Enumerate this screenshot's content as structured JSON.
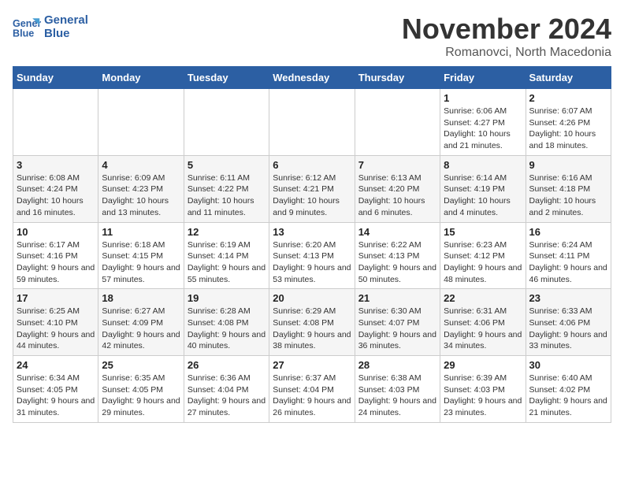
{
  "header": {
    "logo_line1": "General",
    "logo_line2": "Blue",
    "title": "November 2024",
    "subtitle": "Romanovci, North Macedonia"
  },
  "weekdays": [
    "Sunday",
    "Monday",
    "Tuesday",
    "Wednesday",
    "Thursday",
    "Friday",
    "Saturday"
  ],
  "weeks": [
    [
      {
        "day": "",
        "info": ""
      },
      {
        "day": "",
        "info": ""
      },
      {
        "day": "",
        "info": ""
      },
      {
        "day": "",
        "info": ""
      },
      {
        "day": "",
        "info": ""
      },
      {
        "day": "1",
        "info": "Sunrise: 6:06 AM\nSunset: 4:27 PM\nDaylight: 10 hours and 21 minutes."
      },
      {
        "day": "2",
        "info": "Sunrise: 6:07 AM\nSunset: 4:26 PM\nDaylight: 10 hours and 18 minutes."
      }
    ],
    [
      {
        "day": "3",
        "info": "Sunrise: 6:08 AM\nSunset: 4:24 PM\nDaylight: 10 hours and 16 minutes."
      },
      {
        "day": "4",
        "info": "Sunrise: 6:09 AM\nSunset: 4:23 PM\nDaylight: 10 hours and 13 minutes."
      },
      {
        "day": "5",
        "info": "Sunrise: 6:11 AM\nSunset: 4:22 PM\nDaylight: 10 hours and 11 minutes."
      },
      {
        "day": "6",
        "info": "Sunrise: 6:12 AM\nSunset: 4:21 PM\nDaylight: 10 hours and 9 minutes."
      },
      {
        "day": "7",
        "info": "Sunrise: 6:13 AM\nSunset: 4:20 PM\nDaylight: 10 hours and 6 minutes."
      },
      {
        "day": "8",
        "info": "Sunrise: 6:14 AM\nSunset: 4:19 PM\nDaylight: 10 hours and 4 minutes."
      },
      {
        "day": "9",
        "info": "Sunrise: 6:16 AM\nSunset: 4:18 PM\nDaylight: 10 hours and 2 minutes."
      }
    ],
    [
      {
        "day": "10",
        "info": "Sunrise: 6:17 AM\nSunset: 4:16 PM\nDaylight: 9 hours and 59 minutes."
      },
      {
        "day": "11",
        "info": "Sunrise: 6:18 AM\nSunset: 4:15 PM\nDaylight: 9 hours and 57 minutes."
      },
      {
        "day": "12",
        "info": "Sunrise: 6:19 AM\nSunset: 4:14 PM\nDaylight: 9 hours and 55 minutes."
      },
      {
        "day": "13",
        "info": "Sunrise: 6:20 AM\nSunset: 4:13 PM\nDaylight: 9 hours and 53 minutes."
      },
      {
        "day": "14",
        "info": "Sunrise: 6:22 AM\nSunset: 4:13 PM\nDaylight: 9 hours and 50 minutes."
      },
      {
        "day": "15",
        "info": "Sunrise: 6:23 AM\nSunset: 4:12 PM\nDaylight: 9 hours and 48 minutes."
      },
      {
        "day": "16",
        "info": "Sunrise: 6:24 AM\nSunset: 4:11 PM\nDaylight: 9 hours and 46 minutes."
      }
    ],
    [
      {
        "day": "17",
        "info": "Sunrise: 6:25 AM\nSunset: 4:10 PM\nDaylight: 9 hours and 44 minutes."
      },
      {
        "day": "18",
        "info": "Sunrise: 6:27 AM\nSunset: 4:09 PM\nDaylight: 9 hours and 42 minutes."
      },
      {
        "day": "19",
        "info": "Sunrise: 6:28 AM\nSunset: 4:08 PM\nDaylight: 9 hours and 40 minutes."
      },
      {
        "day": "20",
        "info": "Sunrise: 6:29 AM\nSunset: 4:08 PM\nDaylight: 9 hours and 38 minutes."
      },
      {
        "day": "21",
        "info": "Sunrise: 6:30 AM\nSunset: 4:07 PM\nDaylight: 9 hours and 36 minutes."
      },
      {
        "day": "22",
        "info": "Sunrise: 6:31 AM\nSunset: 4:06 PM\nDaylight: 9 hours and 34 minutes."
      },
      {
        "day": "23",
        "info": "Sunrise: 6:33 AM\nSunset: 4:06 PM\nDaylight: 9 hours and 33 minutes."
      }
    ],
    [
      {
        "day": "24",
        "info": "Sunrise: 6:34 AM\nSunset: 4:05 PM\nDaylight: 9 hours and 31 minutes."
      },
      {
        "day": "25",
        "info": "Sunrise: 6:35 AM\nSunset: 4:05 PM\nDaylight: 9 hours and 29 minutes."
      },
      {
        "day": "26",
        "info": "Sunrise: 6:36 AM\nSunset: 4:04 PM\nDaylight: 9 hours and 27 minutes."
      },
      {
        "day": "27",
        "info": "Sunrise: 6:37 AM\nSunset: 4:04 PM\nDaylight: 9 hours and 26 minutes."
      },
      {
        "day": "28",
        "info": "Sunrise: 6:38 AM\nSunset: 4:03 PM\nDaylight: 9 hours and 24 minutes."
      },
      {
        "day": "29",
        "info": "Sunrise: 6:39 AM\nSunset: 4:03 PM\nDaylight: 9 hours and 23 minutes."
      },
      {
        "day": "30",
        "info": "Sunrise: 6:40 AM\nSunset: 4:02 PM\nDaylight: 9 hours and 21 minutes."
      }
    ]
  ]
}
